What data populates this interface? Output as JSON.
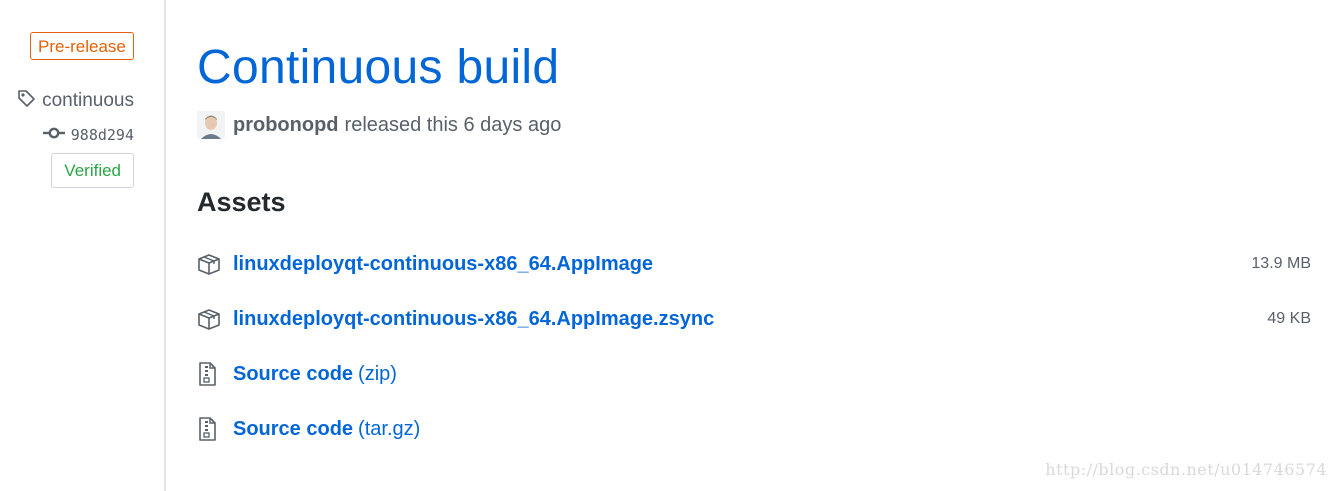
{
  "release": {
    "badge": "Pre-release",
    "tag": "continuous",
    "commit": "988d294",
    "verified_label": "Verified",
    "title": "Continuous build",
    "author": "probonopd",
    "released_text": "released this 6 days ago"
  },
  "assets": {
    "heading": "Assets",
    "items": [
      {
        "name": "linuxdeployqt-continuous-x86_64.AppImage",
        "size": "13.9 MB",
        "icon": "package-icon"
      },
      {
        "name": "linuxdeployqt-continuous-x86_64.AppImage.zsync",
        "size": "49 KB",
        "icon": "package-icon"
      },
      {
        "name": "Source code",
        "ext": "(zip)",
        "icon": "file-zip-icon"
      },
      {
        "name": "Source code",
        "ext": "(tar.gz)",
        "icon": "file-zip-icon"
      }
    ]
  },
  "watermark": "http://blog.csdn.net/u014746574",
  "colors": {
    "link": "#0366d6",
    "prerelease": "#e36209",
    "verified": "#28a745",
    "muted": "#586069"
  }
}
